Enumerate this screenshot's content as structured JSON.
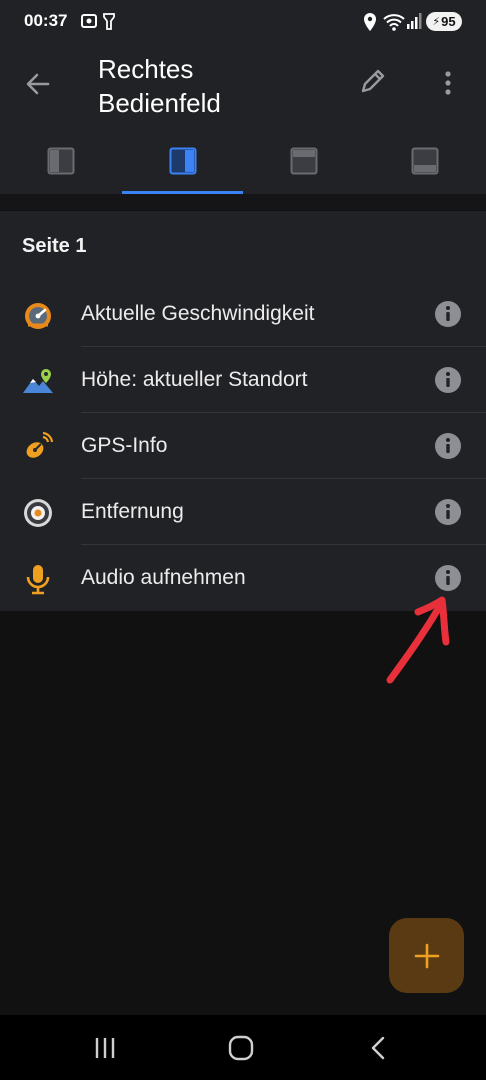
{
  "status_bar": {
    "time": "00:37",
    "battery": "95"
  },
  "header": {
    "title_line1": "Rechtes",
    "title_line2": "Bedienfeld"
  },
  "tabs": [
    {
      "name": "left-panel",
      "active": false
    },
    {
      "name": "right-panel",
      "active": true
    },
    {
      "name": "top-panel",
      "active": false
    },
    {
      "name": "bottom-panel",
      "active": false
    }
  ],
  "section": {
    "title": "Seite 1"
  },
  "items": [
    {
      "label": "Aktuelle Geschwindigkeit",
      "icon": "speedometer-icon"
    },
    {
      "label": "Höhe: aktueller Standort",
      "icon": "altitude-icon"
    },
    {
      "label": "GPS-Info",
      "icon": "gps-satellite-icon"
    },
    {
      "label": "Entfernung",
      "icon": "distance-icon"
    },
    {
      "label": "Audio aufnehmen",
      "icon": "microphone-icon"
    }
  ],
  "colors": {
    "accent": "#3b82f6",
    "orange": "#f0a020",
    "fab_bg": "#5a3a12",
    "annotation": "#e8303a"
  }
}
